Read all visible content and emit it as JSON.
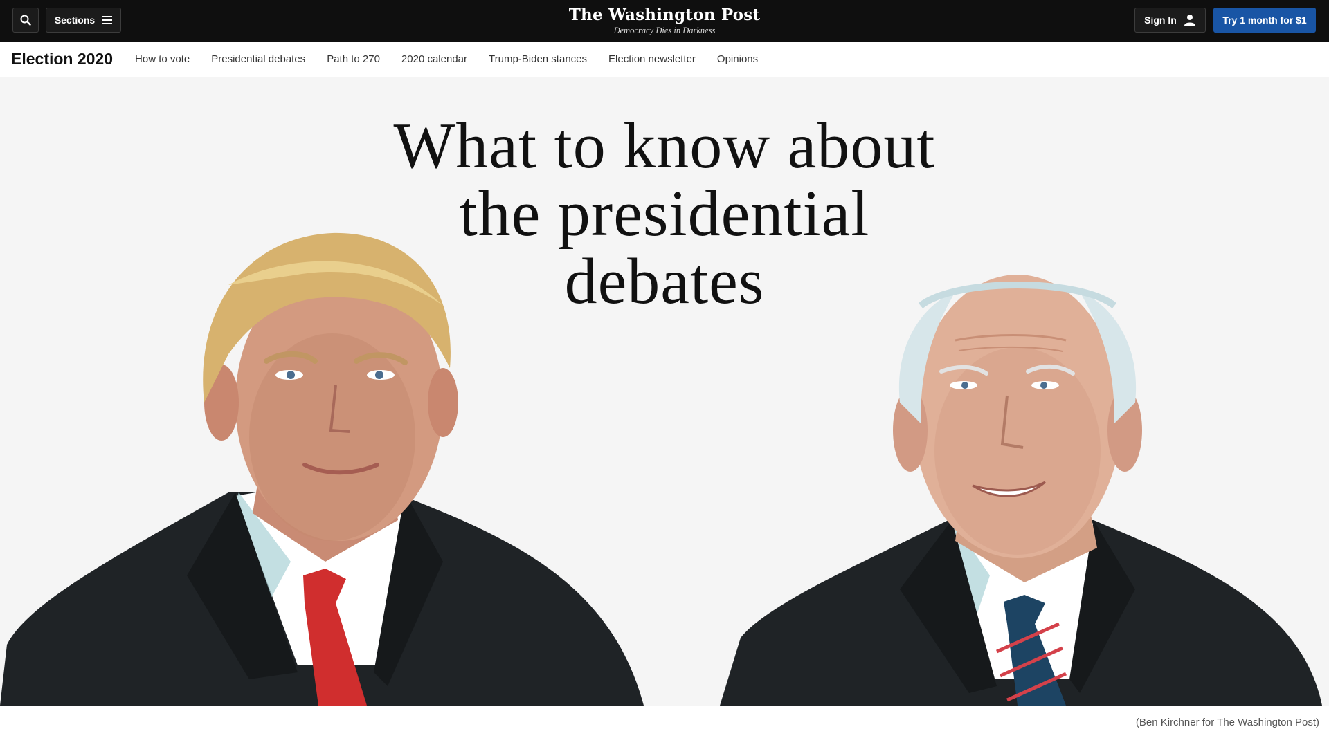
{
  "topbar": {
    "search_icon": "search-icon",
    "sections_label": "Sections",
    "masthead_title": "The Washington Post",
    "masthead_tagline": "Democracy Dies in Darkness",
    "signin_label": "Sign In",
    "user_icon": "user-icon",
    "cta_label": "Try 1 month for $1",
    "cta_color": "#1955a5"
  },
  "subnav": {
    "brand": "Election 2020",
    "links": [
      "How to vote",
      "Presidential debates",
      "Path to 270",
      "2020 calendar",
      "Trump-Biden stances",
      "Election newsletter",
      "Opinions"
    ]
  },
  "hero": {
    "headline": "What to know about the presidential debates",
    "caption": "(Ben Kirchner for The Washington Post)"
  }
}
